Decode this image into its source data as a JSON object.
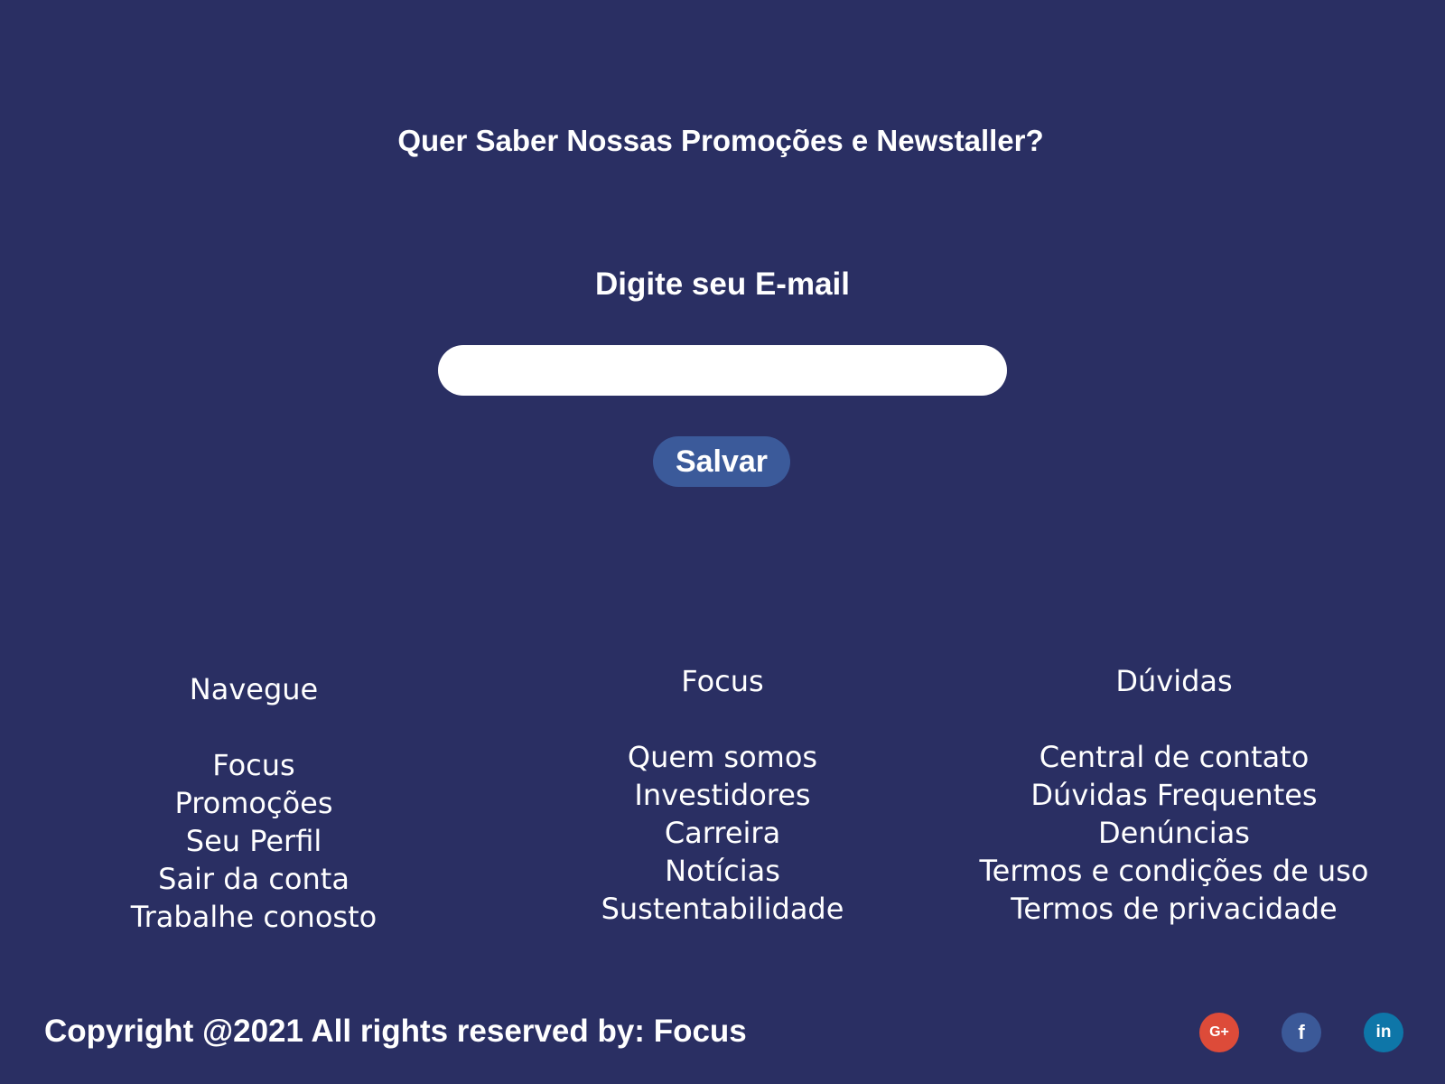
{
  "newsletter": {
    "title": "Quer Saber Nossas Promoções e Newstaller?",
    "email_label": "Digite seu E-mail",
    "email_value": "",
    "save_label": "Salvar"
  },
  "footer": {
    "columns": [
      {
        "heading": "Navegue",
        "links": [
          "Focus",
          "Promoções",
          "Seu Perfil",
          "Sair da conta",
          "Trabalhe conosto"
        ]
      },
      {
        "heading": "Focus",
        "links": [
          "Quem somos",
          "Investidores",
          "Carreira",
          "Notícias",
          "Sustentabilidade"
        ]
      },
      {
        "heading": "Dúvidas",
        "links": [
          "Central de contato",
          "Dúvidas Frequentes",
          "Denúncias",
          "Termos e condições de uso",
          "Termos de privacidade"
        ]
      }
    ],
    "copyright": "Copyright @2021 All rights reserved by: Focus",
    "social": [
      {
        "icon": "google-plus-icon",
        "glyph": "G+",
        "color": "#dd4b39"
      },
      {
        "icon": "facebook-icon",
        "glyph": "f",
        "color": "#3b5998"
      },
      {
        "icon": "linkedin-icon",
        "glyph": "in",
        "color": "#0e76a8"
      }
    ]
  },
  "colors": {
    "background": "#2a2f63",
    "button": "#3b5a9a",
    "text": "#ffffff"
  }
}
